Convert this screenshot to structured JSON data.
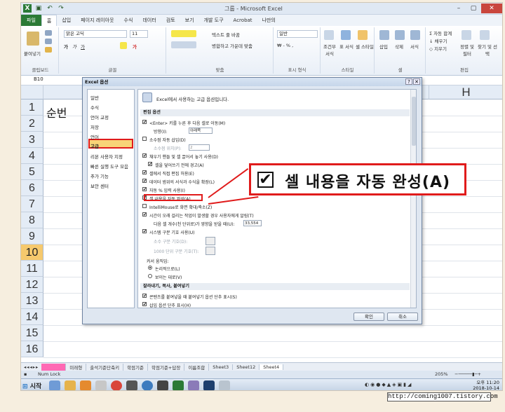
{
  "window": {
    "title": "그룹 - Microsoft Excel"
  },
  "ribbon_tabs": [
    "파일",
    "홈",
    "삽입",
    "페이지 레이아웃",
    "수식",
    "데이터",
    "검토",
    "보기",
    "개발 도구",
    "Acrobat",
    "나만의"
  ],
  "ribbon": {
    "paste": "붙여넣기",
    "clipboard": "클립보드",
    "font_name": "맑은 고딕",
    "font_size": "11",
    "font_group": "글꼴",
    "wrap_text": "텍스트 줄 바꿈",
    "merge": "병합하고 가운데 맞춤",
    "align_group": "맞춤",
    "number_format": "일반",
    "number_group": "표시 형식",
    "cond_format": "조건부 서식",
    "table_format": "표 서식",
    "cell_style": "셀 스타일",
    "style_group": "스타일",
    "insert": "삽입",
    "delete": "삭제",
    "format": "서식",
    "cells_group": "셀",
    "autosum": "자동 합계",
    "fill": "채우기",
    "clear": "지우기",
    "sort": "정렬 및 필터",
    "find": "찾기 및 선택",
    "edit_group": "편집"
  },
  "namebox": "B10",
  "columns": [
    "A",
    "H"
  ],
  "rows": [
    "1",
    "2",
    "3",
    "4",
    "5",
    "6",
    "7",
    "8",
    "9",
    "10",
    "11",
    "12",
    "13",
    "14",
    "15",
    "16"
  ],
  "selected_row": "10",
  "cell_a1": "순번",
  "sheet_tabs": [
    "이름변경",
    "미래형",
    "출석기준단축키",
    "학점기준",
    "학점기준+답장",
    "이름조합",
    "Sheet3",
    "Sheet12",
    "Sheet4"
  ],
  "status": {
    "mode": "Num Lock",
    "zoom": "205%"
  },
  "taskbar": {
    "start": "시작",
    "time": "오후 11:20",
    "date": "2018-10-14"
  },
  "watermark": "http://coming1007.tistory.com",
  "dialog": {
    "title": "Excel 옵션",
    "nav": [
      "일반",
      "수식",
      "언어 교정",
      "저장",
      "언어",
      "고급",
      "리본 사용자 지정",
      "빠른 실행 도구 모음",
      "추가 기능",
      "보안 센터"
    ],
    "selected_nav": "고급",
    "header": "Excel에서 사용하는 고급 옵션입니다.",
    "section_edit": "편집 옵션",
    "opt_enter": "<Enter> 키를 누른 후 다음 셀로 이동(M)",
    "opt_direction": "방향(I):",
    "opt_direction_value": "아래쪽",
    "opt_decimal": "소수점 자동 삽입(D)",
    "opt_decimal_places": "소수점 위치(P):",
    "opt_decimal_value": "2",
    "opt_fill": "채우기 핸들 및 셀 끌어서 놓기 사용(D)",
    "opt_overwrite": "셀을 덮어쓰기 전에 경고(A)",
    "opt_incell": "셀에서 직접 편집 허용(E)",
    "opt_extend": "데이터 범위의 서식과 수식을 확장(L)",
    "opt_percent": "자동 % 입력 사용(I)",
    "opt_autocomplete": "셀 내용을 자동 완성(A)",
    "opt_intellimouse": "IntelliMouse로 화면 확대/축소(Z)",
    "opt_alert": "시간이 오래 걸리는 작업이 발생할 경우 사용자에게 알림(T)",
    "opt_affected": "다음 셀 개수(천 단위로)가 영향을 받을 때(U):",
    "opt_affected_value": "33,554",
    "opt_system_sep": "시스템 구분 기호 사용(U)",
    "opt_dec_sep": "소수 구분 기호(D):",
    "opt_thousand_sep": "1000 단위 구분 기호(T):",
    "section_cursor": "커서 움직임:",
    "opt_logical": "논리적으로(L)",
    "opt_visual": "보이는 대로(V)",
    "section_paste": "잘라내기, 복사, 붙여넣기",
    "opt_paste_btn": "콘텐츠를 붙여넣을 때 붙여넣기 옵션 단추 표시(S)",
    "opt_insert_btn": "삽입 옵션 단추 표시(H)",
    "ok": "확인",
    "cancel": "취소"
  },
  "callout": {
    "text": "셀 내용을 자동 완성(A)",
    "check": "✔"
  },
  "colors": {
    "accent": "#e01b1b",
    "excel_green": "#2b7a36",
    "selected_row": "#f6c96d",
    "highlight_tab": "#ff69b4"
  }
}
